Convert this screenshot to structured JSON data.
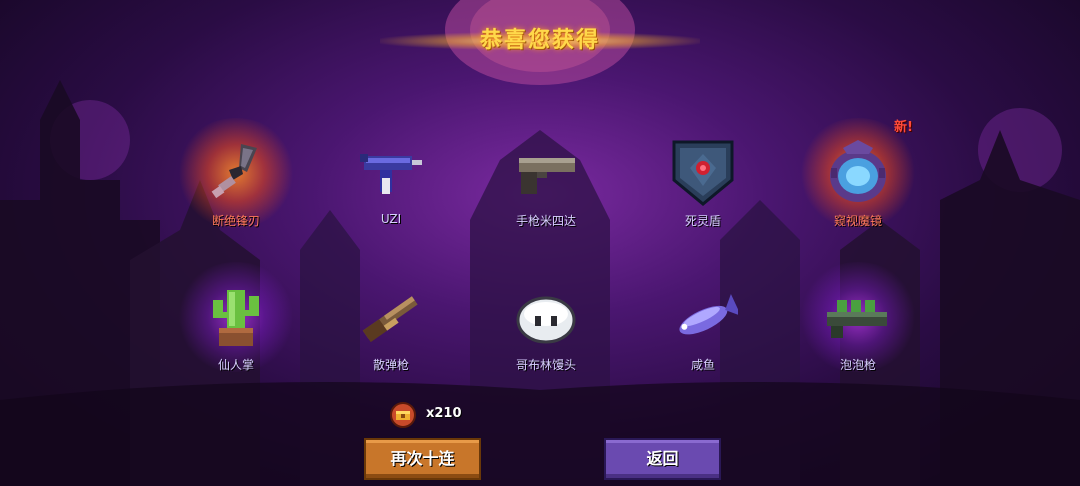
{
  "title": "恭喜您获得",
  "items": [
    {
      "name": "断绝锋刃",
      "glow": "orange",
      "label_color": "red",
      "icon": "broken-blade-icon"
    },
    {
      "name": "UZI",
      "glow": "",
      "label_color": "normal",
      "icon": "uzi-icon"
    },
    {
      "name": "手枪米四达",
      "glow": "",
      "label_color": "normal",
      "icon": "pistol-icon"
    },
    {
      "name": "死灵盾",
      "glow": "",
      "label_color": "normal",
      "icon": "shield-icon"
    },
    {
      "name": "窥视魔镜",
      "glow": "orange",
      "label_color": "red",
      "icon": "magic-mirror-icon",
      "badge": "新!"
    },
    {
      "name": "仙人掌",
      "glow": "purple",
      "label_color": "normal",
      "icon": "cactus-icon"
    },
    {
      "name": "散弹枪",
      "glow": "",
      "label_color": "normal",
      "icon": "shotgun-icon"
    },
    {
      "name": "哥布林馒头",
      "glow": "",
      "label_color": "normal",
      "icon": "goblin-bun-icon"
    },
    {
      "name": "咸鱼",
      "glow": "",
      "label_color": "normal",
      "icon": "salted-fish-icon"
    },
    {
      "name": "泡泡枪",
      "glow": "purple",
      "label_color": "normal",
      "icon": "bubble-gun-icon"
    }
  ],
  "cost": {
    "amount": "x210",
    "icon": "treasure-chest-icon"
  },
  "buttons": {
    "again": "再次十连",
    "back": "返回"
  },
  "colors": {
    "title": "#ffd84a",
    "rare_label": "#ff7a5a",
    "label": "#d8d0ff",
    "again_button": "#c8762a",
    "back_button": "#6a4ab0"
  }
}
